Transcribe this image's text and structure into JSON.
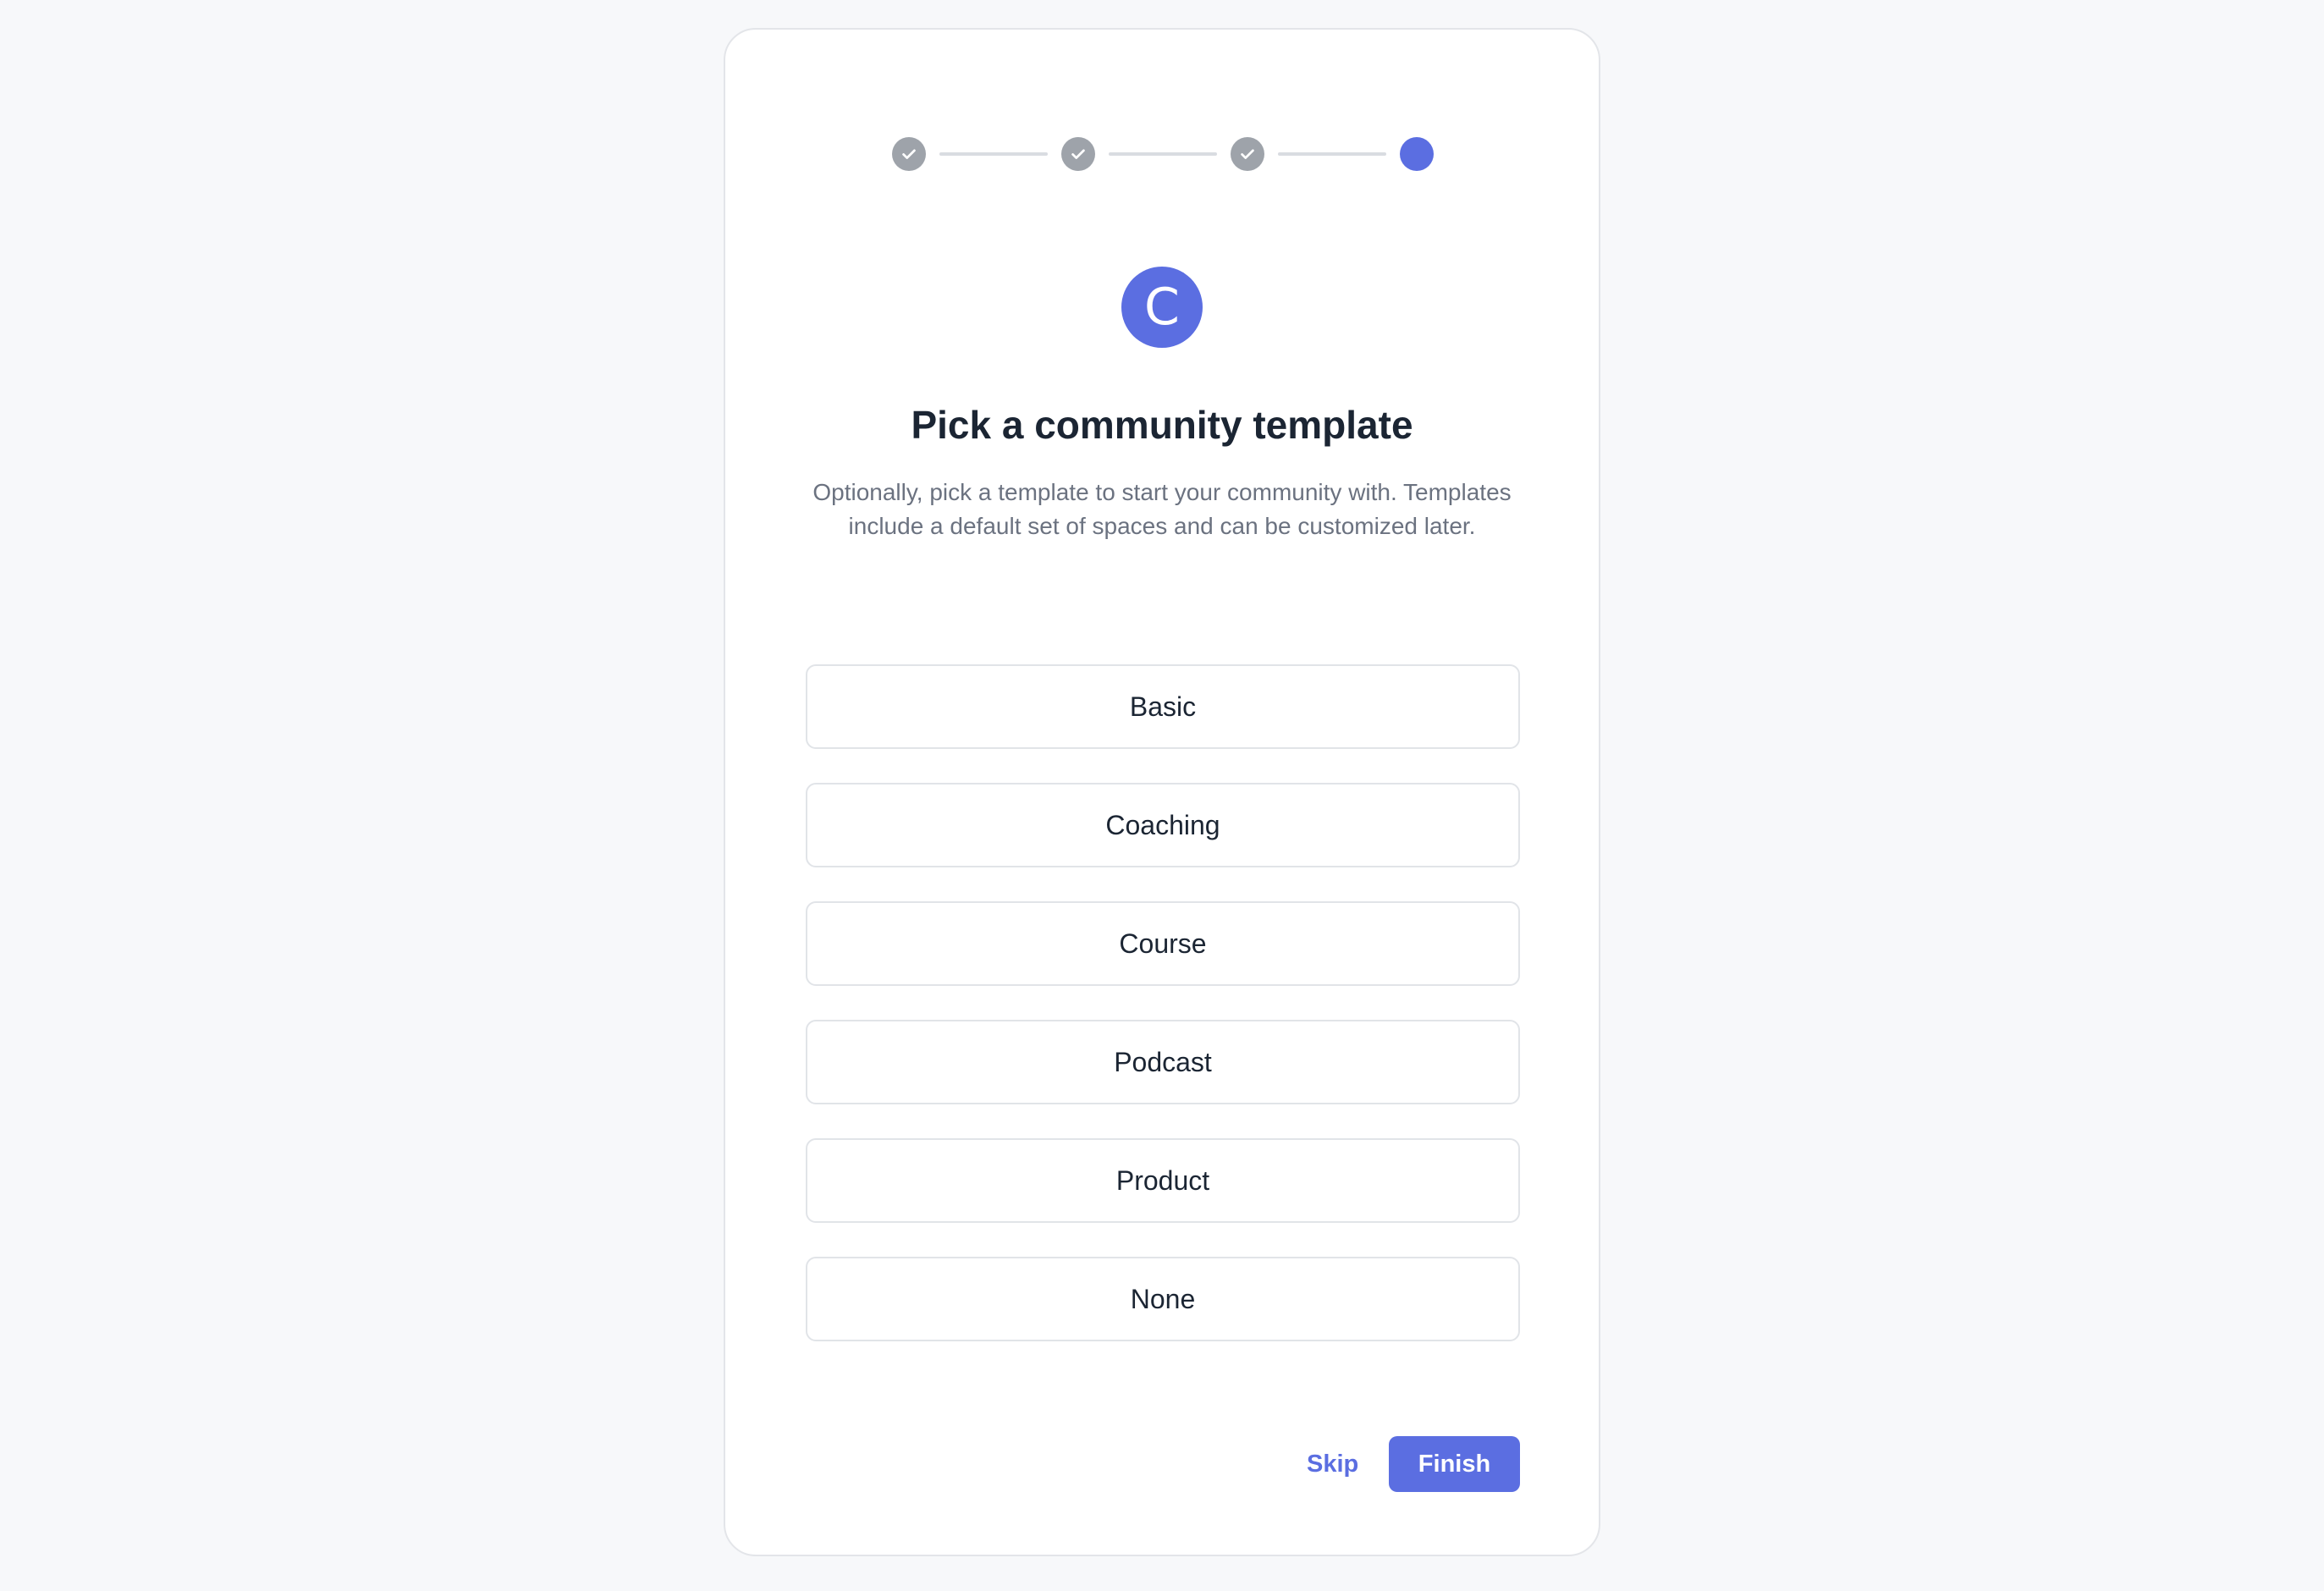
{
  "stepper": {
    "steps": [
      {
        "status": "complete",
        "icon": "check-icon"
      },
      {
        "status": "complete",
        "icon": "check-icon"
      },
      {
        "status": "complete",
        "icon": "check-icon"
      },
      {
        "status": "current",
        "icon": ""
      }
    ],
    "colors": {
      "complete": "#9ea3aa",
      "current": "#5b6ee1",
      "connector": "#d9dce1"
    }
  },
  "logo": {
    "letter": "C",
    "color": "#5b6ee1"
  },
  "header": {
    "title": "Pick a community template",
    "subtitle": "Optionally, pick a template to start your community with. Templates include a default set of spaces and can be customized later."
  },
  "templates": [
    {
      "label": "Basic"
    },
    {
      "label": "Coaching"
    },
    {
      "label": "Course"
    },
    {
      "label": "Podcast"
    },
    {
      "label": "Product"
    },
    {
      "label": "None"
    }
  ],
  "footer": {
    "skip_label": "Skip",
    "finish_label": "Finish"
  },
  "accent_color": "#5b6ee1"
}
